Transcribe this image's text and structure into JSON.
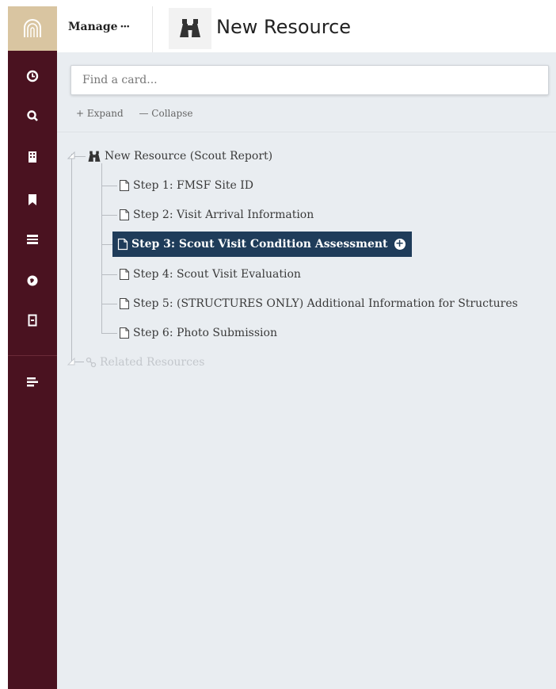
{
  "header": {
    "manage_label": "Manage",
    "manage_dots": "···",
    "title": "New Resource",
    "title_icon": "binoculars-icon"
  },
  "sidebar": {
    "logo_icon": "arches-logo-icon",
    "icons": [
      "clock-icon",
      "search-icon",
      "building-icon",
      "bookmark-icon",
      "list-icon",
      "globe-icon",
      "grid-icon",
      "report-icon"
    ]
  },
  "search": {
    "placeholder": "Find a card...",
    "value": ""
  },
  "toolbar": {
    "expand_label": "+ Expand",
    "collapse_label": "— Collapse"
  },
  "tree": {
    "root_label": "New Resource (Scout Report)",
    "steps": [
      "Step 1: FMSF Site ID",
      "Step 2: Visit Arrival Information",
      "Step 3: Scout Visit Condition Assessment",
      "Step 4: Scout Visit Evaluation",
      "Step 5: (STRUCTURES ONLY) Additional Information for Structures",
      "Step 6: Photo Submission"
    ],
    "selected_index": 2,
    "related_label": "Related Resources"
  },
  "colors": {
    "sidebar": "#4a1220",
    "logo_bg": "#d9c5a1",
    "selected_bg": "#1f3c5a",
    "panel_bg": "#e9edf1"
  }
}
